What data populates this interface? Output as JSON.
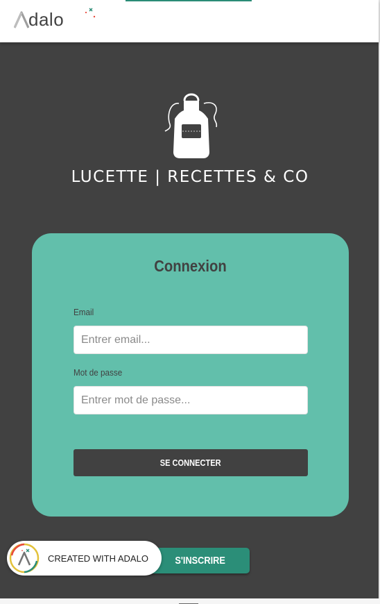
{
  "topbar": {
    "brand_name": "Adalo",
    "brand_icon": "adalo-logo",
    "accent_color": "#2a8c76"
  },
  "app": {
    "logo_icon": "apron-icon",
    "title": "LUCETTE | RECETTES & CO",
    "background_color": "#414141"
  },
  "login_card": {
    "title": "Connexion",
    "card_color": "#62bfab",
    "email": {
      "label": "Email",
      "placeholder": "Entrer email...",
      "value": ""
    },
    "password": {
      "label": "Mot de passe",
      "placeholder": "Entrer mot de passe...",
      "value": ""
    },
    "submit_label": "SE CONNECTER"
  },
  "signup": {
    "label": "S'INSCRIRE",
    "color": "#2b8e78"
  },
  "made_with_badge": {
    "text": "CREATED WITH ADALO",
    "icon": "adalo-badge-icon"
  }
}
